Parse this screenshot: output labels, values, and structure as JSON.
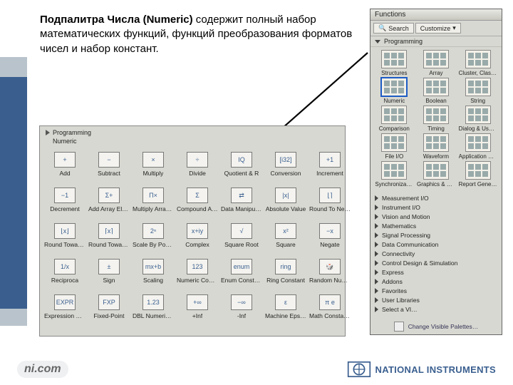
{
  "description": {
    "bold": "Подпалитра Числа (Numeric)",
    "rest": " содержит полный набор математических функций, функций преобразования форматов чисел и набор констант."
  },
  "numeric_panel": {
    "breadcrumb_root": "Programming",
    "breadcrumb_leaf": "Numeric",
    "items": [
      {
        "label": "Add",
        "glyph": "+"
      },
      {
        "label": "Subtract",
        "glyph": "−"
      },
      {
        "label": "Multiply",
        "glyph": "×"
      },
      {
        "label": "Divide",
        "glyph": "÷"
      },
      {
        "label": "Quotient & R",
        "glyph": "IQ"
      },
      {
        "label": "Conversion",
        "glyph": "[i32]"
      },
      {
        "label": "Increment",
        "glyph": "+1"
      },
      {
        "label": "Decrement",
        "glyph": "−1"
      },
      {
        "label": "Add Array Ele…",
        "glyph": "Σ+"
      },
      {
        "label": "Multiply Array…",
        "glyph": "Π×"
      },
      {
        "label": "Compound Ar…",
        "glyph": "Σ"
      },
      {
        "label": "Data Manipul…",
        "glyph": "⇄"
      },
      {
        "label": "Absolute Value",
        "glyph": "|x|"
      },
      {
        "label": "Round To Ne…",
        "glyph": "⌊⌉"
      },
      {
        "label": "Round Towar…",
        "glyph": "⌊x⌋"
      },
      {
        "label": "Round Towar…",
        "glyph": "⌈x⌉"
      },
      {
        "label": "Scale By Pow…",
        "glyph": "2ⁿ"
      },
      {
        "label": "Complex",
        "glyph": "x+iy"
      },
      {
        "label": "Square Root",
        "glyph": "√"
      },
      {
        "label": "Square",
        "glyph": "x²"
      },
      {
        "label": "Negate",
        "glyph": "−x"
      },
      {
        "label": "Reciproca",
        "glyph": "1/x"
      },
      {
        "label": "Sign",
        "glyph": "±"
      },
      {
        "label": "Scaling",
        "glyph": "mx+b"
      },
      {
        "label": "Numeric Cons…",
        "glyph": "123"
      },
      {
        "label": "Enum Constant",
        "glyph": "enum"
      },
      {
        "label": "Ring Constant",
        "glyph": "ring"
      },
      {
        "label": "Random Num…",
        "glyph": "🎲"
      },
      {
        "label": "Expression N…",
        "glyph": "EXPR"
      },
      {
        "label": "Fixed-Point",
        "glyph": "FXP"
      },
      {
        "label": "DBL Numeric …",
        "glyph": "1.23"
      },
      {
        "label": "+Inf",
        "glyph": "+∞"
      },
      {
        "label": "-Inf",
        "glyph": "−∞"
      },
      {
        "label": "Machine Epsilon",
        "glyph": "ε"
      },
      {
        "label": "Math Constants",
        "glyph": "π e"
      }
    ]
  },
  "functions_window": {
    "title": "Functions",
    "toolbar": {
      "search": "Search",
      "customize": "Customize"
    },
    "section_open": "Programming",
    "categories": [
      {
        "label": "Structures",
        "selected": false
      },
      {
        "label": "Array",
        "selected": false
      },
      {
        "label": "Cluster, Class…",
        "selected": false
      },
      {
        "label": "Numeric",
        "selected": true
      },
      {
        "label": "Boolean",
        "selected": false
      },
      {
        "label": "String",
        "selected": false
      },
      {
        "label": "Comparison",
        "selected": false
      },
      {
        "label": "Timing",
        "selected": false
      },
      {
        "label": "Dialog & User…",
        "selected": false
      },
      {
        "label": "File I/O",
        "selected": false
      },
      {
        "label": "Waveform",
        "selected": false
      },
      {
        "label": "Application C…",
        "selected": false
      },
      {
        "label": "Synchronizat…",
        "selected": false
      },
      {
        "label": "Graphics & So…",
        "selected": false
      },
      {
        "label": "Report Gener…",
        "selected": false
      }
    ],
    "collapsed_sections": [
      "Measurement I/O",
      "Instrument I/O",
      "Vision and Motion",
      "Mathematics",
      "Signal Processing",
      "Data Communication",
      "Connectivity",
      "Control Design & Simulation",
      "Express",
      "Addons",
      "Favorites",
      "User Libraries",
      "Select a VI…"
    ],
    "footer": "Change Visible Palettes…"
  },
  "footer": {
    "nicom": "ni.com",
    "brand": "NATIONAL INSTRUMENTS"
  }
}
